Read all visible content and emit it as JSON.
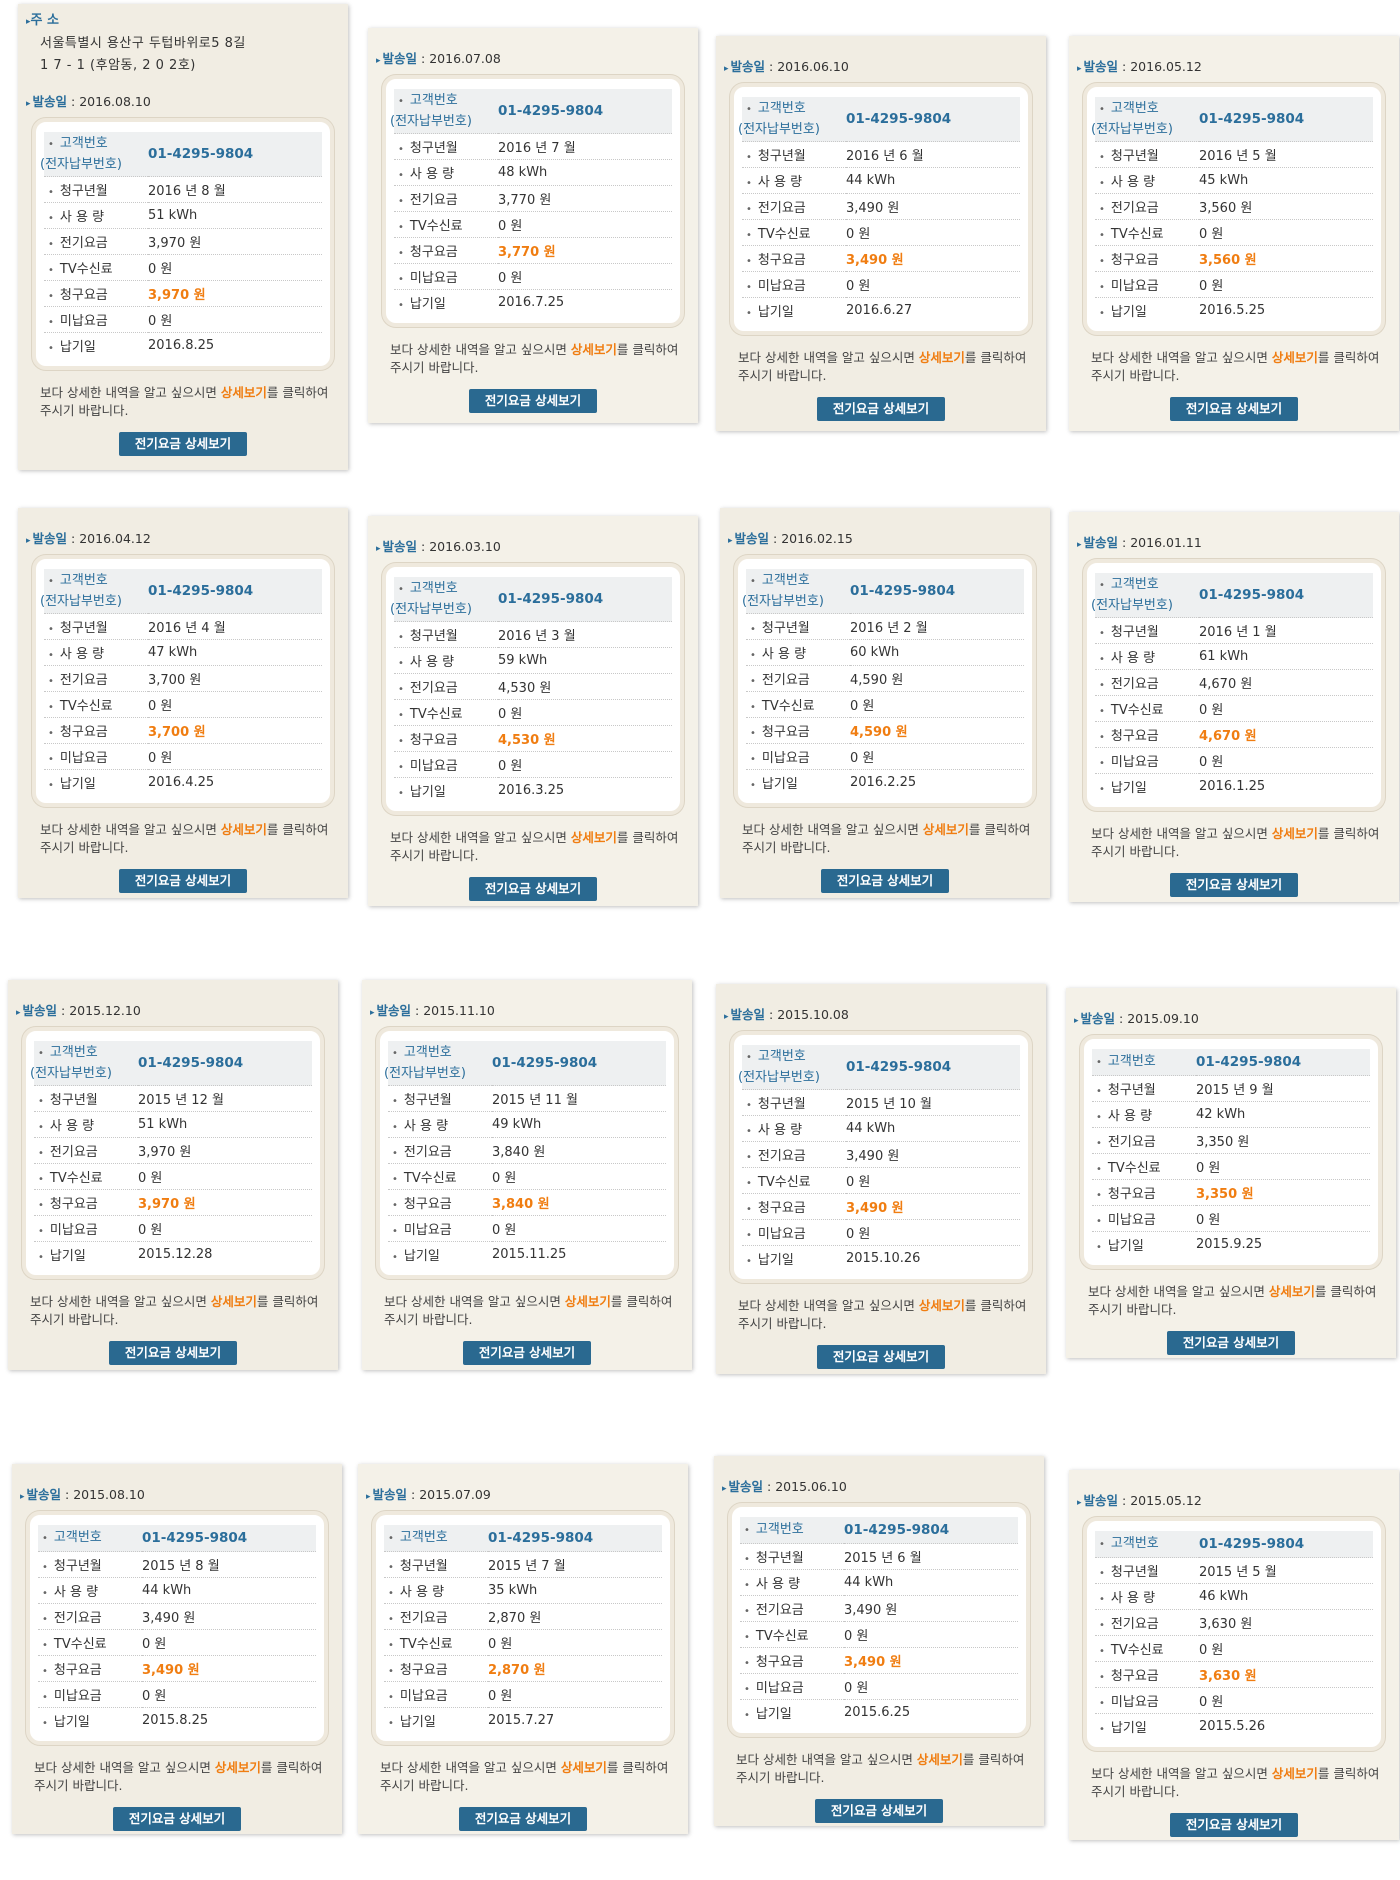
{
  "address": {
    "heading": "주 소",
    "line1": "서울특별시  용산구  두텁바위로5 8길",
    "line2": "1 7 - 1    (후암동,  2 0 2호)"
  },
  "labels": {
    "sent": "발송일",
    "customer": "고객번호",
    "customer_sub": "(전자납부번호)",
    "billing_month": "청구년월",
    "usage": "사 용 량",
    "electricity_fee": "전기요금",
    "tv_fee": "TV수신료",
    "billed_amount": "청구요금",
    "unpaid": "미납요금",
    "due_date": "납기일",
    "note_before": "보다 상세한 내역을 알고 싶으시면 ",
    "note_detail": "상세보기",
    "note_after": "를 클릭하여 주시기 바랍니다.",
    "button": "전기요금 상세보기"
  },
  "cards": [
    {
      "sent": "2016.08.10",
      "customer": "01-4295-9804",
      "month": "2016 년 8 월",
      "usage": "51 kWh",
      "fee": "3,970 원",
      "tv": "0 원",
      "billed": "3,970 원",
      "unpaid": "0 원",
      "due": "2016.8.25"
    },
    {
      "sent": "2016.07.08",
      "customer": "01-4295-9804",
      "month": "2016 년 7 월",
      "usage": "48 kWh",
      "fee": "3,770 원",
      "tv": "0 원",
      "billed": "3,770 원",
      "unpaid": "0 원",
      "due": "2016.7.25"
    },
    {
      "sent": "2016.06.10",
      "customer": "01-4295-9804",
      "month": "2016 년 6 월",
      "usage": "44 kWh",
      "fee": "3,490 원",
      "tv": "0 원",
      "billed": "3,490 원",
      "unpaid": "0 원",
      "due": "2016.6.27"
    },
    {
      "sent": "2016.05.12",
      "customer": "01-4295-9804",
      "month": "2016 년 5 월",
      "usage": "45 kWh",
      "fee": "3,560 원",
      "tv": "0 원",
      "billed": "3,560 원",
      "unpaid": "0 원",
      "due": "2016.5.25"
    },
    {
      "sent": "2016.04.12",
      "customer": "01-4295-9804",
      "month": "2016 년 4 월",
      "usage": "47 kWh",
      "fee": "3,700 원",
      "tv": "0 원",
      "billed": "3,700 원",
      "unpaid": "0 원",
      "due": "2016.4.25"
    },
    {
      "sent": "2016.03.10",
      "customer": "01-4295-9804",
      "month": "2016 년 3 월",
      "usage": "59 kWh",
      "fee": "4,530 원",
      "tv": "0 원",
      "billed": "4,530 원",
      "unpaid": "0 원",
      "due": "2016.3.25"
    },
    {
      "sent": "2016.02.15",
      "customer": "01-4295-9804",
      "month": "2016 년 2 월",
      "usage": "60 kWh",
      "fee": "4,590 원",
      "tv": "0 원",
      "billed": "4,590 원",
      "unpaid": "0 원",
      "due": "2016.2.25"
    },
    {
      "sent": "2016.01.11",
      "customer": "01-4295-9804",
      "month": "2016 년 1 월",
      "usage": "61 kWh",
      "fee": "4,670 원",
      "tv": "0 원",
      "billed": "4,670 원",
      "unpaid": "0 원",
      "due": "2016.1.25"
    },
    {
      "sent": "2015.12.10",
      "customer": "01-4295-9804",
      "month": "2015 년 12 월",
      "usage": "51 kWh",
      "fee": "3,970 원",
      "tv": "0 원",
      "billed": "3,970 원",
      "unpaid": "0 원",
      "due": "2015.12.28"
    },
    {
      "sent": "2015.11.10",
      "customer": "01-4295-9804",
      "month": "2015 년 11 월",
      "usage": "49 kWh",
      "fee": "3,840 원",
      "tv": "0 원",
      "billed": "3,840 원",
      "unpaid": "0 원",
      "due": "2015.11.25"
    },
    {
      "sent": "2015.10.08",
      "customer": "01-4295-9804",
      "month": "2015 년 10 월",
      "usage": "44 kWh",
      "fee": "3,490 원",
      "tv": "0 원",
      "billed": "3,490 원",
      "unpaid": "0 원",
      "due": "2015.10.26"
    },
    {
      "sent": "2015.09.10",
      "customer": "01-4295-9804",
      "month": "2015 년 9 월",
      "usage": "42 kWh",
      "fee": "3,350 원",
      "tv": "0 원",
      "billed": "3,350 원",
      "unpaid": "0 원",
      "due": "2015.9.25"
    },
    {
      "sent": "2015.08.10",
      "customer": "01-4295-9804",
      "month": "2015 년 8 월",
      "usage": "44 kWh",
      "fee": "3,490 원",
      "tv": "0 원",
      "billed": "3,490 원",
      "unpaid": "0 원",
      "due": "2015.8.25"
    },
    {
      "sent": "2015.07.09",
      "customer": "01-4295-9804",
      "month": "2015 년 7 월",
      "usage": "35 kWh",
      "fee": "2,870 원",
      "tv": "0 원",
      "billed": "2,870 원",
      "unpaid": "0 원",
      "due": "2015.7.27"
    },
    {
      "sent": "2015.06.10",
      "customer": "01-4295-9804",
      "month": "2015 년 6 월",
      "usage": "44 kWh",
      "fee": "3,490 원",
      "tv": "0 원",
      "billed": "3,490 원",
      "unpaid": "0 원",
      "due": "2015.6.25"
    },
    {
      "sent": "2015.05.12",
      "customer": "01-4295-9804",
      "month": "2015 년 5 월",
      "usage": "46 kWh",
      "fee": "3,630 원",
      "tv": "0 원",
      "billed": "3,630 원",
      "unpaid": "0 원",
      "due": "2015.5.26"
    }
  ]
}
